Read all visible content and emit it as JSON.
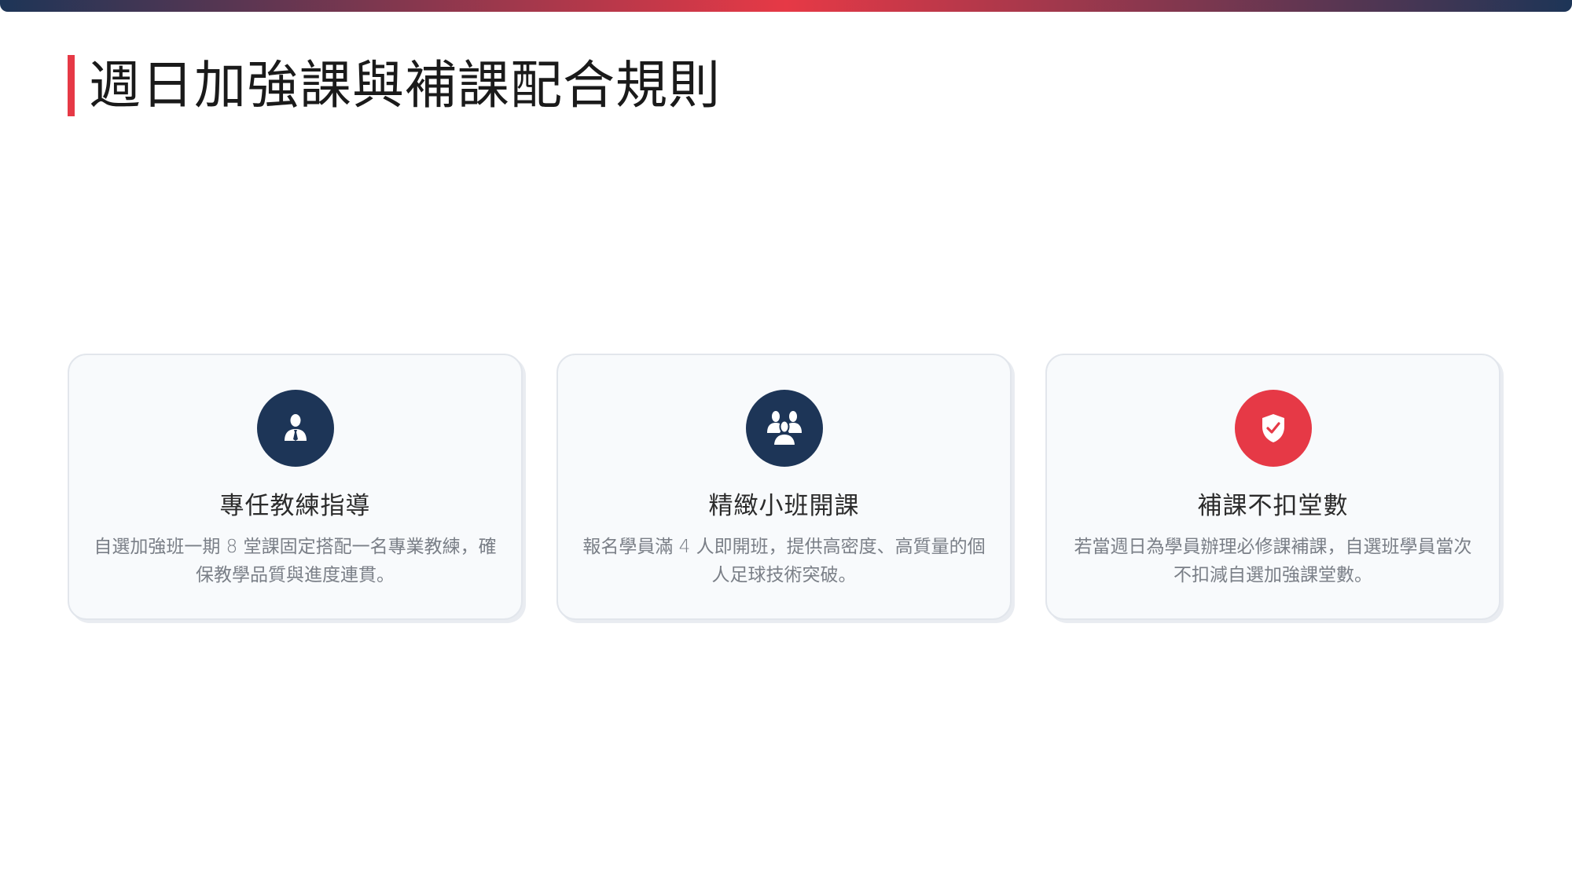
{
  "colors": {
    "accent_red": "#e63946",
    "navy": "#1d3557",
    "top_bar_gradient": [
      "#1d3557",
      "#e63946",
      "#1d3557"
    ]
  },
  "slide": {
    "title": "週日加強課與補課配合規則"
  },
  "cards": [
    {
      "icon": "user-tie-icon",
      "icon_color": "#1d3557",
      "title": "專任教練指導",
      "description": "自選加強班一期 8 堂課固定搭配一名專業教練，確保教學品質與進度連貫。"
    },
    {
      "icon": "users-icon",
      "icon_color": "#1d3557",
      "title": "精緻小班開課",
      "description": "報名學員滿 4 人即開班，提供高密度、高質量的個人足球技術突破。"
    },
    {
      "icon": "shield-check-icon",
      "icon_color": "#e63946",
      "title": "補課不扣堂數",
      "description": "若當週日為學員辦理必修課補課，自選班學員當次不扣減自選加強課堂數。"
    }
  ]
}
